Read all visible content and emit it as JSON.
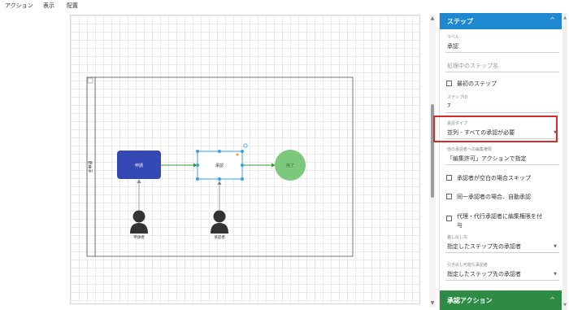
{
  "menubar": {
    "items": [
      {
        "label": "アクション"
      },
      {
        "label": "表示"
      },
      {
        "label": "配置"
      }
    ]
  },
  "diagram": {
    "swimlane_label": "全申請",
    "nodes": {
      "apply": {
        "label": "申請"
      },
      "approve": {
        "label": "承認"
      },
      "done": {
        "label": "完了"
      }
    },
    "actors": {
      "applicant": {
        "label": "申請者"
      },
      "approver": {
        "label": "承認者"
      }
    }
  },
  "panel": {
    "header": {
      "title": "ステップ"
    },
    "label_field": {
      "label": "ラベル",
      "value": "承認"
    },
    "processing_name": {
      "placeholder": "処理中のステップ名"
    },
    "first_step": {
      "label": "最初のステップ"
    },
    "step_id": {
      "label": "ステップID",
      "value": "7"
    },
    "approval_type": {
      "label": "承認タイプ",
      "value": "並列 - すべての承認が必要"
    },
    "edit_permission": {
      "label": "他の承認者への編集権限",
      "value": "「編集許可」アクションで指定"
    },
    "skip_empty": {
      "label": "承認者が空白の場合スキップ"
    },
    "auto_approve": {
      "label": "同一承認者の場合、自動承認"
    },
    "proxy_edit": {
      "label_line1": "代理・代行承認者に編集権限を付",
      "label_line2": "与"
    },
    "send_back": {
      "label": "差し戻し先",
      "value": "指定したステップ先の承認者"
    },
    "pull_back": {
      "label": "引き戻し可能な承認者",
      "value": "指定したステップ先の承認者"
    },
    "footer": {
      "title": "承認アクション"
    }
  },
  "colors": {
    "header_blue": "#1e88d1",
    "footer_green": "#2e8b45",
    "highlight_red": "#d62b2b",
    "node_apply": "#3549b5",
    "node_done": "#7cc87c",
    "selection": "#3aa0e0",
    "flow_arrow": "#3a9a3a"
  },
  "icons": {
    "collapse": "chevron-up-icon",
    "dropdown": "chevron-down-icon",
    "actor": "person-icon"
  }
}
